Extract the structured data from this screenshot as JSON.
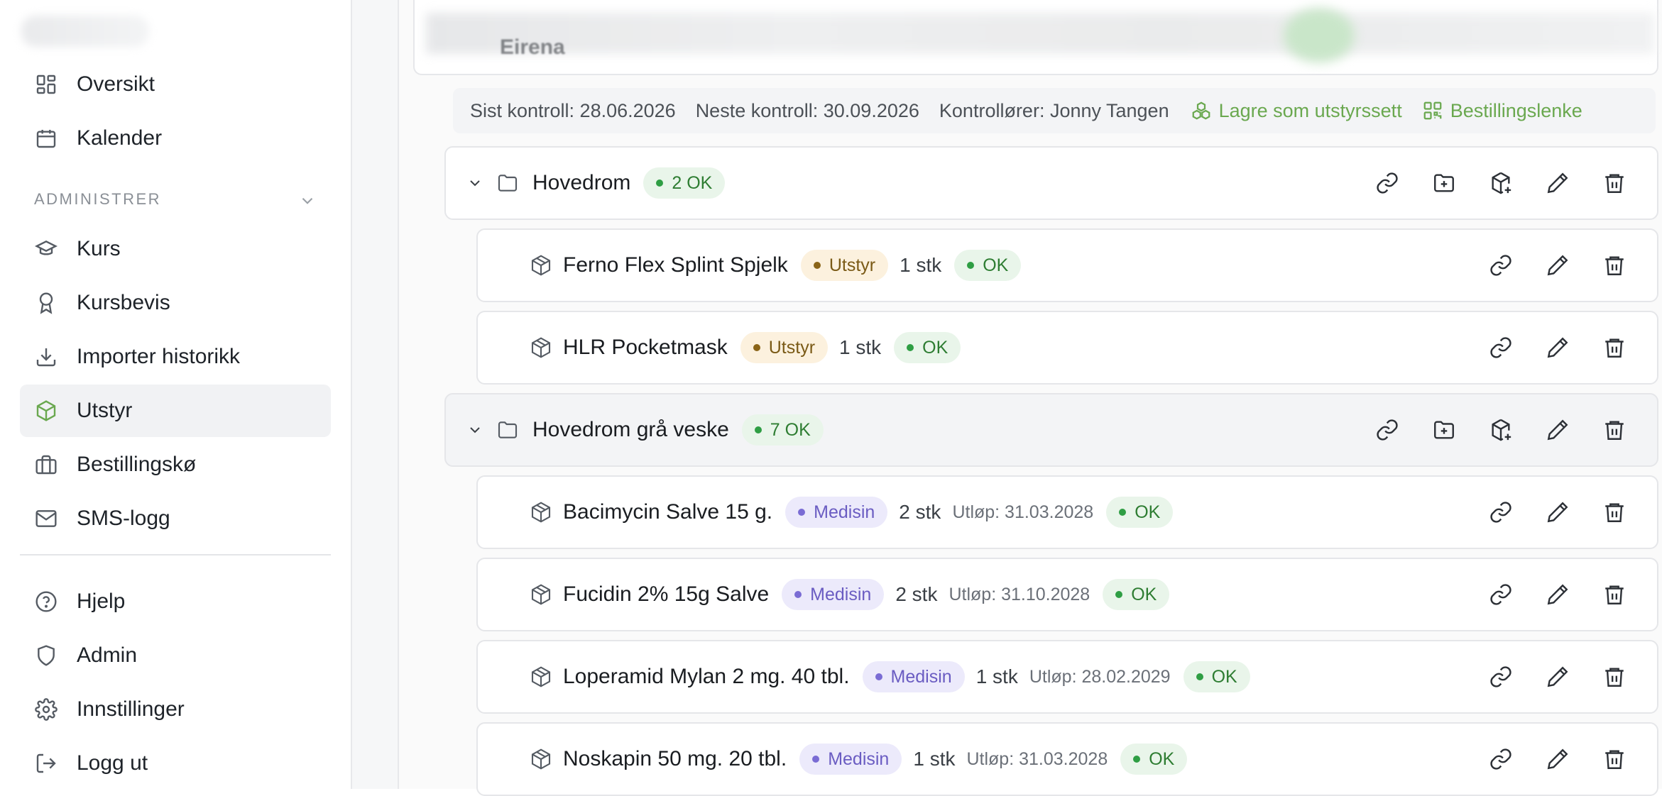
{
  "sidebar": {
    "nav_top": [
      {
        "label": "Oversikt",
        "icon": "grid-icon"
      },
      {
        "label": "Kalender",
        "icon": "calendar-icon"
      }
    ],
    "section_label": "ADMINISTRER",
    "nav_admin": [
      {
        "label": "Kurs",
        "icon": "graduation-cap-icon"
      },
      {
        "label": "Kursbevis",
        "icon": "award-icon"
      },
      {
        "label": "Importer historikk",
        "icon": "download-icon"
      },
      {
        "label": "Utstyr",
        "icon": "package-icon",
        "active": true
      },
      {
        "label": "Bestillingskø",
        "icon": "briefcase-icon"
      },
      {
        "label": "SMS-logg",
        "icon": "mail-icon"
      }
    ],
    "nav_bottom": [
      {
        "label": "Hjelp",
        "icon": "help-circle-icon"
      },
      {
        "label": "Admin",
        "icon": "shield-icon"
      },
      {
        "label": "Innstillinger",
        "icon": "gear-icon"
      },
      {
        "label": "Logg ut",
        "icon": "logout-icon"
      }
    ]
  },
  "header": {
    "title_partial": "Eirena"
  },
  "info_bar": {
    "last_check": "Sist kontroll: 28.06.2026",
    "next_check": "Neste kontroll: 30.09.2026",
    "controllers": "Kontrollører: Jonny Tangen",
    "save_as_set": "Lagre som utstyrssett",
    "order_link": "Bestillingslenke"
  },
  "colors": {
    "accent_green": "#6aa84f",
    "ok_green": "#2f9e44",
    "utstyr_brown": "#8a6418",
    "medisin_purple": "#7a6cd4"
  },
  "folders": [
    {
      "name": "Hovedrom",
      "status": "2 OK",
      "items": [
        {
          "name": "Ferno Flex Splint Spjelk",
          "category": "Utstyr",
          "qty": "1 stk",
          "expiry": "",
          "status": "OK"
        },
        {
          "name": "HLR Pocketmask",
          "category": "Utstyr",
          "qty": "1 stk",
          "expiry": "",
          "status": "OK"
        }
      ]
    },
    {
      "name": "Hovedrom grå veske",
      "status": "7 OK",
      "items": [
        {
          "name": "Bacimycin Salve 15 g.",
          "category": "Medisin",
          "qty": "2 stk",
          "expiry": "Utløp: 31.03.2028",
          "status": "OK"
        },
        {
          "name": "Fucidin 2% 15g Salve",
          "category": "Medisin",
          "qty": "2 stk",
          "expiry": "Utløp: 31.10.2028",
          "status": "OK"
        },
        {
          "name": "Loperamid Mylan 2 mg. 40 tbl.",
          "category": "Medisin",
          "qty": "1 stk",
          "expiry": "Utløp: 28.02.2029",
          "status": "OK"
        },
        {
          "name": "Noskapin 50 mg. 20 tbl.",
          "category": "Medisin",
          "qty": "1 stk",
          "expiry": "Utløp: 31.03.2028",
          "status": "OK"
        }
      ]
    }
  ]
}
